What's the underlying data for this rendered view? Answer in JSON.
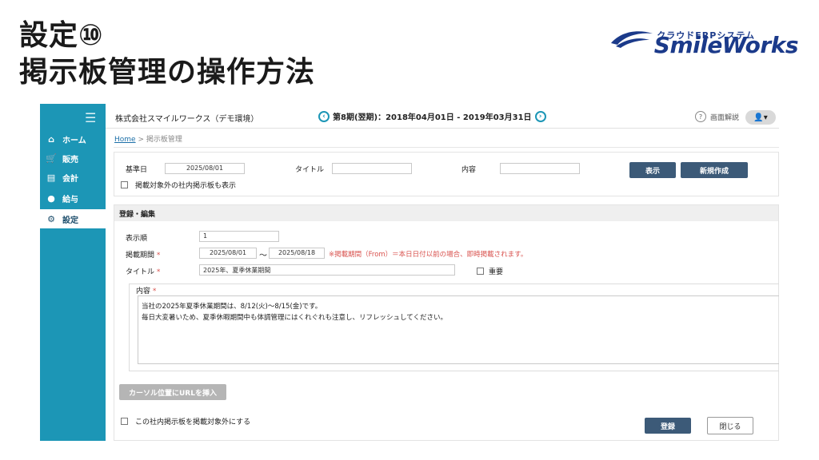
{
  "slide": {
    "title_line1": "設定⑩",
    "title_line2": "掲示板管理の操作方法"
  },
  "logo": {
    "subtitle": "クラウドERPシステム",
    "name": "SmileWorks",
    "brand_color": "#1b3a8a"
  },
  "sidebar": {
    "accent": "#1c96b6",
    "menu_icon": "hamburger-icon",
    "items": [
      {
        "label": "ホーム",
        "icon": "home-icon"
      },
      {
        "label": "販売",
        "icon": "cart-icon"
      },
      {
        "label": "会計",
        "icon": "calculator-icon"
      },
      {
        "label": "給与",
        "icon": "money-bag-icon"
      },
      {
        "label": "設定",
        "icon": "gear-icon",
        "active": true
      }
    ]
  },
  "header": {
    "company": "株式会社スマイルワークス（デモ環境）",
    "period": "第8期(翌期)：2018年04月01日 - 2019年03月31日",
    "help": "画面解説",
    "user_icon": "user-icon"
  },
  "breadcrumb": {
    "home": "Home",
    "separator": ">",
    "current": "掲示板管理"
  },
  "search": {
    "date_label": "基準日",
    "date_value": "2025/08/01",
    "title_label": "タイトル",
    "title_value": "",
    "content_label": "内容",
    "content_value": "",
    "show_other_label": "掲載対象外の社内掲示板も表示",
    "show_button": "表示",
    "new_button": "新規作成"
  },
  "edit": {
    "header": "登録・編集",
    "order_label": "表示順",
    "order_value": "1",
    "period_label": "掲載期間",
    "required_mark": "*",
    "period_from": "2025/08/01",
    "period_sep": "〜",
    "period_to": "2025/08/18",
    "period_note": "※掲載期間（From）＝本日日付以前の場合、即時掲載されます。",
    "title_label": "タイトル",
    "title_value": "2025年、夏季休業期間",
    "important_label": "重要",
    "content_label": "内容",
    "content_line1": "当社の2025年夏季休業期間は、8/12(火)〜8/15(金)です。",
    "content_line2": "毎日大変暑いため、夏季休暇期間中も体調管理にはくれぐれも注意し、リフレッシュしてください。",
    "insert_url_button": "カーソル位置にURLを挿入",
    "exclude_label": "この社内掲示板を掲載対象外にする",
    "register_button": "登録",
    "close_button": "閉じる"
  }
}
